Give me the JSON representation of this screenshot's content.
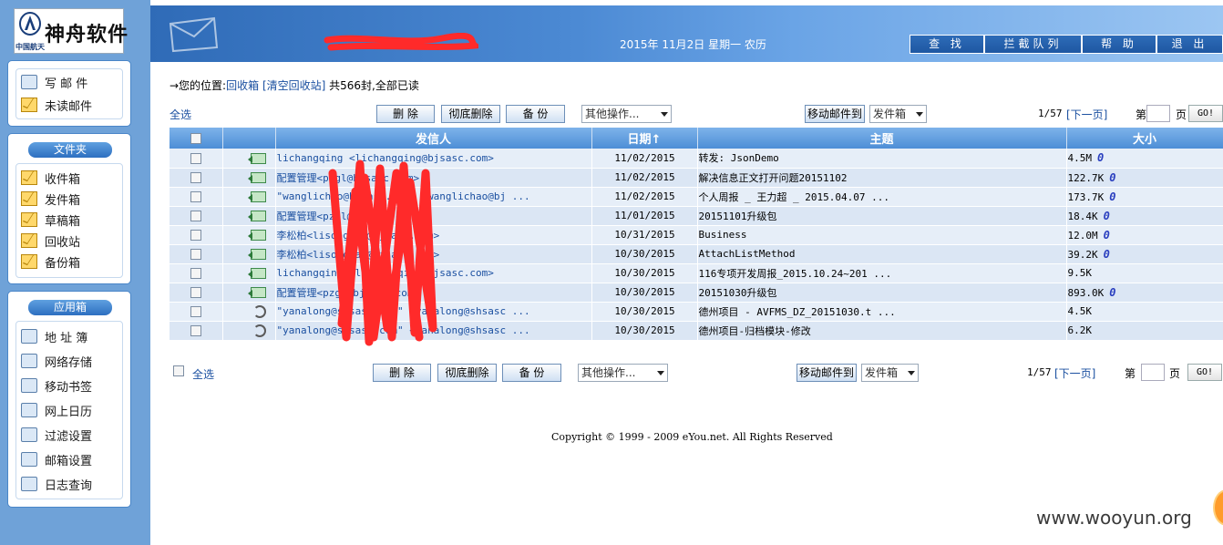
{
  "logo": {
    "text": "神舟软件",
    "subtext": "中国航天"
  },
  "header": {
    "date": "2015年 11月2日 星期一 农历",
    "buttons": [
      "查 找",
      "拦截队列",
      "帮 助",
      "退 出"
    ]
  },
  "sidebar": {
    "compose": "写 邮 件",
    "unread": "未读邮件",
    "folders_title": "文件夹",
    "folders": [
      "收件箱",
      "发件箱",
      "草稿箱",
      "回收站",
      "备份箱"
    ],
    "apps_title": "应用箱",
    "apps": [
      "地 址 簿",
      "网络存储",
      "移动书签",
      "网上日历",
      "过滤设置",
      "邮箱设置",
      "日志查询"
    ]
  },
  "breadcrumb": {
    "prefix": "→您的位置:",
    "location": "回收箱",
    "action": "[清空回收站]",
    "summary": "共566封,全部已读"
  },
  "toolbar": {
    "select_all": "全选",
    "delete": "删 除",
    "purge": "彻底删除",
    "backup": "备 份",
    "other_ops": "其他操作...",
    "move_to": "移动邮件到",
    "move_target": "发件箱",
    "page_info": "1/57",
    "next_page": "[下一页]",
    "page_prefix": "第",
    "page_suffix": "页",
    "go": "GO!"
  },
  "table": {
    "headers": {
      "sender": "发信人",
      "date": "日期",
      "sort_arrow": "↑",
      "subject": "主题",
      "size": "大小"
    },
    "rows": [
      {
        "icon": "reply",
        "sender": "lichangqing <lichangqing@bjsasc.com>",
        "date": "11/02/2015",
        "subject": "转发: JsonDemo",
        "size": "4.5M",
        "attach": true
      },
      {
        "icon": "reply",
        "sender": "配置管理<pzgl@bjsasc.com>",
        "date": "11/02/2015",
        "subject": "解决信息正文打开问题20151102",
        "size": "122.7K",
        "attach": true
      },
      {
        "icon": "reply",
        "sender": "\"wanglichao@bjsasc.com\" <wanglichao@bj ...",
        "date": "11/02/2015",
        "subject": "个人周报 _ 王力超 _ 2015.04.07 ...",
        "size": "173.7K",
        "attach": true
      },
      {
        "icon": "reply",
        "sender": "配置管理<pzgl@bjsasc.com>",
        "date": "11/01/2015",
        "subject": "20151101升级包",
        "size": "18.4K",
        "attach": true
      },
      {
        "icon": "reply",
        "sender": "李松柏<lisongbai@bjsasc.com>",
        "date": "10/31/2015",
        "subject": "Business",
        "size": "12.0M",
        "attach": true
      },
      {
        "icon": "reply",
        "sender": "李松柏<lisongbai@bjsasc.com>",
        "date": "10/30/2015",
        "subject": "AttachListMethod",
        "size": "39.2K",
        "attach": true
      },
      {
        "icon": "reply",
        "sender": "lichangqing <lichangqing@bjsasc.com>",
        "date": "10/30/2015",
        "subject": "116专项开发周报_2015.10.24~201 ...",
        "size": "9.5K",
        "attach": false
      },
      {
        "icon": "reply",
        "sender": "配置管理<pzgl@bjsasc.com>",
        "date": "10/30/2015",
        "subject": "20151030升级包",
        "size": "893.0K",
        "attach": true
      },
      {
        "icon": "forward",
        "sender": "\"yanalong@shsasc.com\" <yanalong@shsasc ...",
        "date": "10/30/2015",
        "subject": "德州项目 - AVFMS_DZ_20151030.t ...",
        "size": "4.5K",
        "attach": false
      },
      {
        "icon": "forward",
        "sender": "\"yanalong@shsasc.com\" <yanalong@shsasc ...",
        "date": "10/30/2015",
        "subject": "德州项目-归档模块-修改",
        "size": "6.2K",
        "attach": false
      }
    ]
  },
  "footer": "Copyright © 1999 - 2009 eYou.net. All Rights Reserved",
  "watermark": "www.wooyun.org",
  "colors": {
    "sidebar": "#6fa2d8",
    "header_row": "#4d8ed6",
    "row_a": "#e6eef8",
    "row_b": "#dbe6f4",
    "link": "#1a4fa0",
    "redaction": "#ff2a2a"
  }
}
